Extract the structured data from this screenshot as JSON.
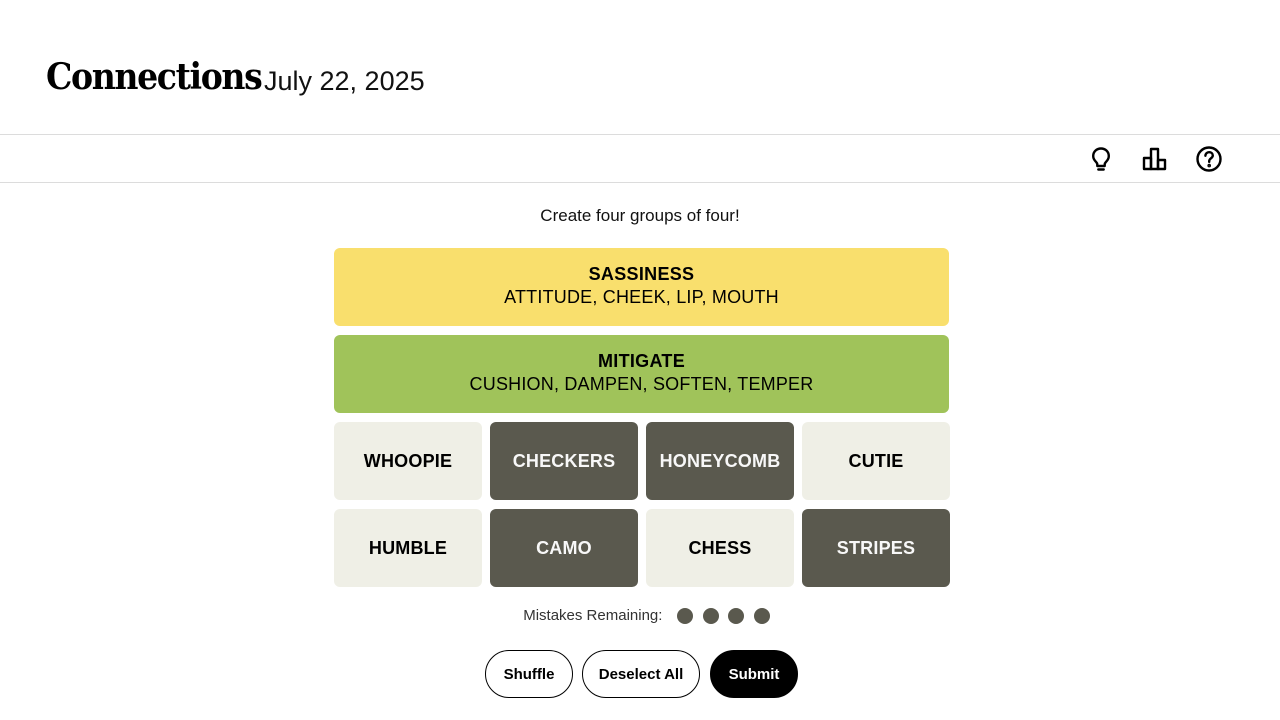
{
  "header": {
    "title": "Connections",
    "date": "July 22, 2025"
  },
  "toolbar": {
    "icons": [
      "hint-lightbulb-icon",
      "stats-bar-chart-icon",
      "help-question-icon"
    ]
  },
  "instructions": "Create four groups of four!",
  "solved_groups": [
    {
      "title": "SASSINESS",
      "members": "ATTITUDE, CHEEK, LIP, MOUTH",
      "color": "#f9df6d"
    },
    {
      "title": "MITIGATE",
      "members": "CUSHION, DAMPEN, SOFTEN, TEMPER",
      "color": "#a0c35a"
    }
  ],
  "tiles": [
    {
      "word": "WHOOPIE",
      "selected": false
    },
    {
      "word": "CHECKERS",
      "selected": true
    },
    {
      "word": "HONEYCOMB",
      "selected": true
    },
    {
      "word": "CUTIE",
      "selected": false
    },
    {
      "word": "HUMBLE",
      "selected": false
    },
    {
      "word": "CAMO",
      "selected": true
    },
    {
      "word": "CHESS",
      "selected": false
    },
    {
      "word": "STRIPES",
      "selected": true
    }
  ],
  "mistakes": {
    "label": "Mistakes Remaining:",
    "remaining": 4
  },
  "buttons": {
    "shuffle": "Shuffle",
    "deselect": "Deselect All",
    "submit": "Submit"
  },
  "colors": {
    "selected_tile": "#5a594e",
    "unselected_tile": "#efefe6",
    "yellow_group": "#f9df6d",
    "green_group": "#a0c35a"
  }
}
